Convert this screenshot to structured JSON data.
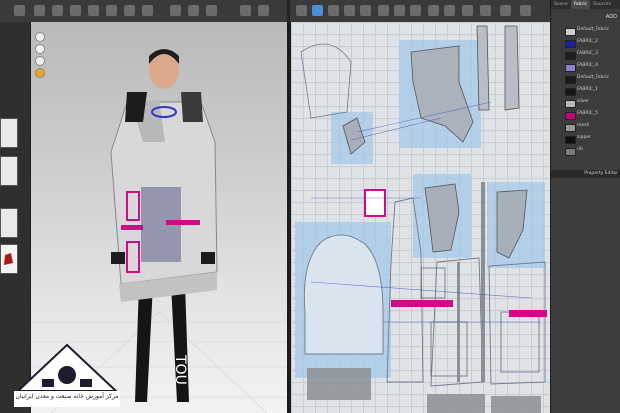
{
  "right_panel": {
    "tabs": [
      "Scene",
      "Fabric",
      "Sources"
    ],
    "add_label": "ADD",
    "fabrics": [
      {
        "name": "Default_Fabric",
        "color": "#cfcfcf"
      },
      {
        "name": "FABRIC_2",
        "color": "#1f1fa0"
      },
      {
        "name": "FABRIC_3",
        "color": "#1f1f1f"
      },
      {
        "name": "FABRIC_4",
        "color": "#8b7fd6"
      },
      {
        "name": "Default_Fabric",
        "color": "#1a1a1a"
      },
      {
        "name": "FABRIC_1",
        "color": "#151515"
      },
      {
        "name": "silver",
        "color": "#b8b8b8"
      },
      {
        "name": "FABRIC_5",
        "color": "#c4007a"
      },
      {
        "name": "mesh",
        "color": "#9a9a9a"
      },
      {
        "name": "zipper",
        "color": "#0f0f0f"
      },
      {
        "name": "rib",
        "color": "#7a7a7a"
      }
    ],
    "property_title": "Property Editor"
  },
  "logo": {
    "caption": "مرکز آموزش خانه صنعت و معدن ایرانیان"
  }
}
